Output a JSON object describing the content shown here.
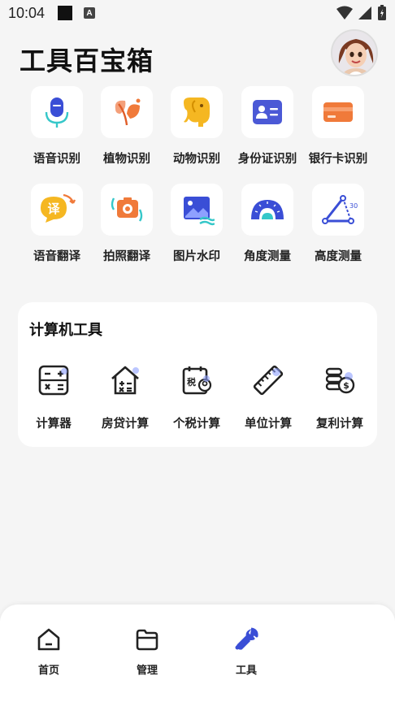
{
  "status_bar": {
    "time": "10:04",
    "badge": "A"
  },
  "header": {
    "title": "工具百宝箱"
  },
  "tools_row1": [
    {
      "label": "语音识别",
      "icon": "microphone-icon"
    },
    {
      "label": "植物识别",
      "icon": "leaf-icon"
    },
    {
      "label": "动物识别",
      "icon": "elephant-icon"
    },
    {
      "label": "身份证识别",
      "icon": "id-card-icon"
    },
    {
      "label": "银行卡识别",
      "icon": "bank-card-icon"
    }
  ],
  "tools_row2": [
    {
      "label": "语音翻译",
      "icon": "translate-bubble-icon",
      "glyph": "译"
    },
    {
      "label": "拍照翻译",
      "icon": "camera-translate-icon"
    },
    {
      "label": "图片水印",
      "icon": "image-watermark-icon"
    },
    {
      "label": "角度测量",
      "icon": "protractor-icon"
    },
    {
      "label": "高度测量",
      "icon": "height-angle-icon",
      "glyph": "30°"
    }
  ],
  "calculator": {
    "title": "计算机工具",
    "items": [
      {
        "label": "计算器",
        "icon": "calculator-icon"
      },
      {
        "label": "房贷计算",
        "icon": "house-loan-icon"
      },
      {
        "label": "个税计算",
        "icon": "tax-icon",
        "glyph": "税"
      },
      {
        "label": "单位计算",
        "icon": "ruler-icon"
      },
      {
        "label": "复利计算",
        "icon": "coin-stack-icon"
      }
    ]
  },
  "bottom_nav": [
    {
      "label": "首页",
      "icon": "home-icon",
      "active": false
    },
    {
      "label": "管理",
      "icon": "folder-icon",
      "active": false
    },
    {
      "label": "工具",
      "icon": "wrench-icon",
      "active": true
    }
  ],
  "colors": {
    "accent": "#3a4ed6",
    "orange": "#f07a3a",
    "background": "#f5f5f5"
  }
}
